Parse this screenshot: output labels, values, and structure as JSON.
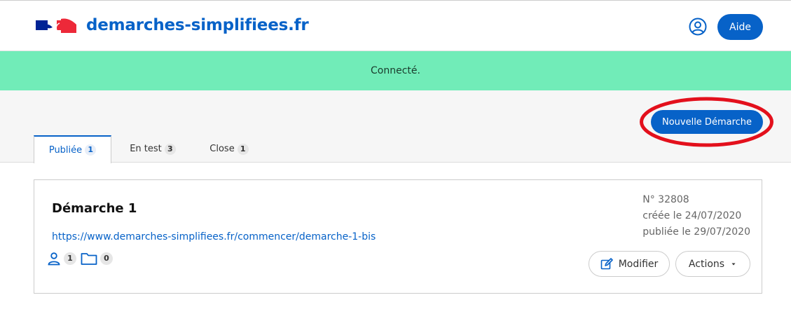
{
  "header": {
    "brand": "demarches-simplifiees.fr",
    "help_label": "Aide",
    "user_icon": "user-circle-icon",
    "logo_colors": [
      "#002395",
      "#ffffff",
      "#ed2939"
    ]
  },
  "flash": {
    "message": "Connecté."
  },
  "toolbar": {
    "new_button_label": "Nouvelle Démarche",
    "tabs": [
      {
        "label": "Publiée",
        "count": "1",
        "active": true
      },
      {
        "label": "En test",
        "count": "3",
        "active": false
      },
      {
        "label": "Close",
        "count": "1",
        "active": false
      }
    ]
  },
  "procedure": {
    "title": "Démarche 1",
    "link": "https://www.demarches-simplifiees.fr/commencer/demarche-1-bis",
    "admins_count": "1",
    "dossiers_count": "0",
    "number": "N° 32808",
    "created": "créée le 24/07/2020",
    "published": "publiée le 29/07/2020",
    "modify_label": "Modifier",
    "actions_label": "Actions"
  },
  "colors": {
    "primary": "#0762c8",
    "flash_bg": "#71ecb8",
    "highlight": "#e3101c"
  }
}
